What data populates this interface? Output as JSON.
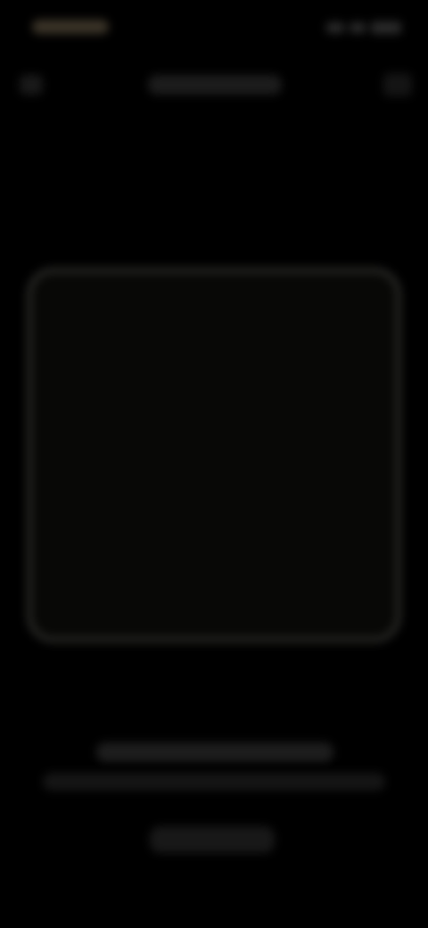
{
  "colors": {
    "background": "#000000",
    "frame_border": "#2a2a27",
    "frame_fill": "#080806",
    "status_time": "#3a3327"
  },
  "icons": {
    "back": "back-icon",
    "menu": "menu-icon",
    "signal": "signal-icon",
    "battery": "battery-icon"
  }
}
